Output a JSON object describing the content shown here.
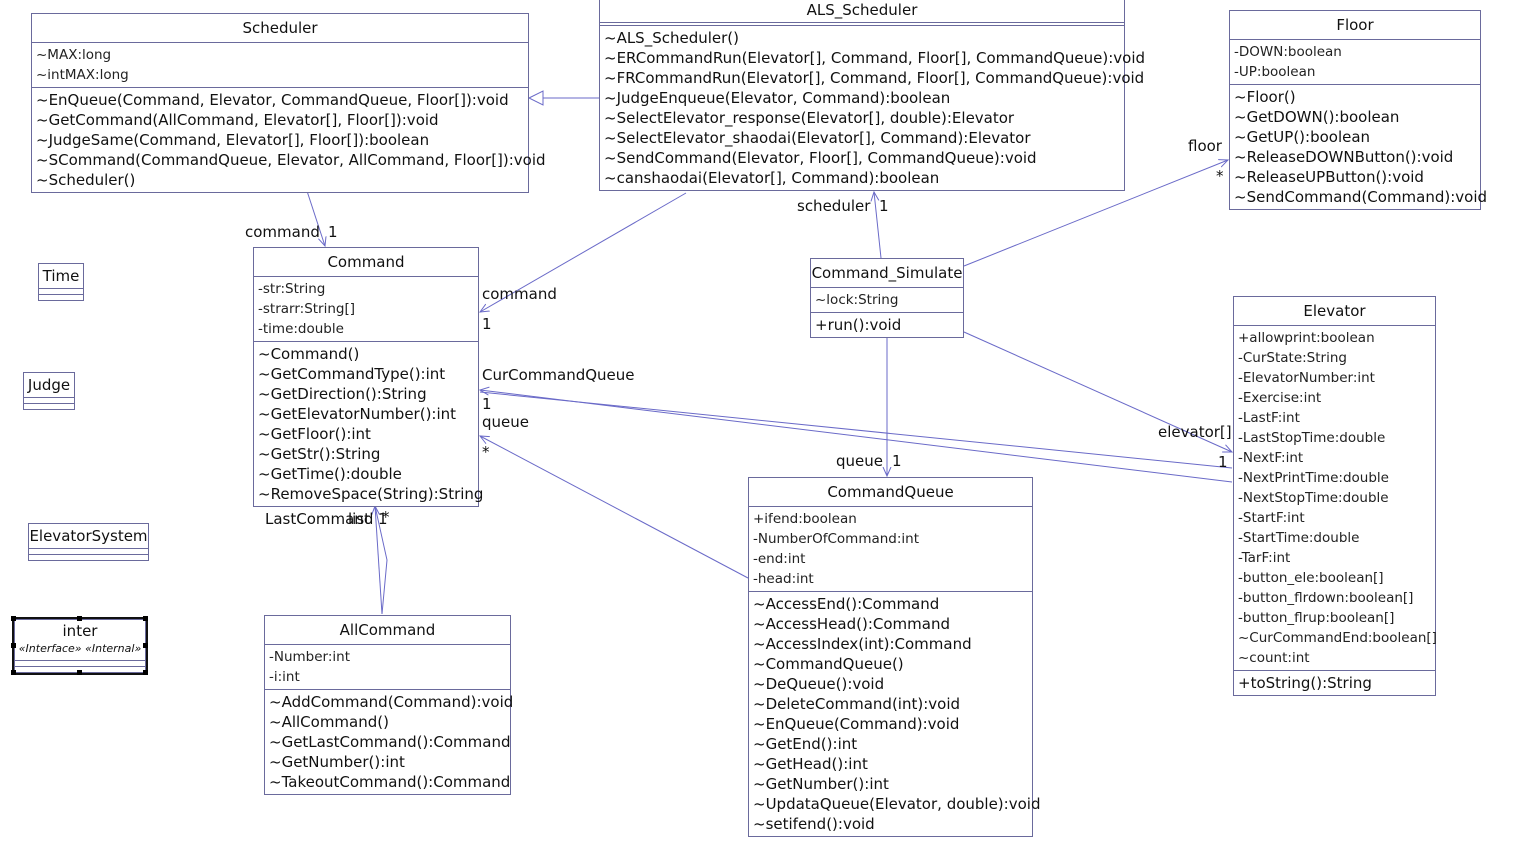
{
  "classes": [
    {
      "id": "scheduler",
      "name": "Scheduler",
      "attributes": [
        "~MAX:long",
        "~intMAX:long"
      ],
      "methods": [
        "~EnQueue(Command, Elevator, CommandQueue, Floor[]):void",
        "~GetCommand(AllCommand, Elevator[], Floor[]):void",
        "~JudgeSame(Command, Elevator[], Floor[]):boolean",
        "~SCommand(CommandQueue, Elevator, AllCommand, Floor[]):void",
        "~Scheduler()"
      ]
    },
    {
      "id": "als",
      "name": "ALS_Scheduler",
      "attributes": [],
      "methods": [
        "~ALS_Scheduler()",
        "~ERCommandRun(Elevator[], Command, Floor[], CommandQueue):void",
        "~FRCommandRun(Elevator[], Command, Floor[], CommandQueue):void",
        "~JudgeEnqueue(Elevator, Command):boolean",
        "~SelectElevator_response(Elevator[], double):Elevator",
        "~SelectElevator_shaodai(Elevator[], Command):Elevator",
        "~SendCommand(Elevator, Floor[], CommandQueue):void",
        "~canshaodai(Elevator[], Command):boolean"
      ]
    },
    {
      "id": "floor",
      "name": "Floor",
      "attributes": [
        "-DOWN:boolean",
        "-UP:boolean"
      ],
      "methods": [
        "~Floor()",
        "~GetDOWN():boolean",
        "~GetUP():boolean",
        "~ReleaseDOWNButton():void",
        "~ReleaseUPButton():void",
        "~SendCommand(Command):void"
      ]
    },
    {
      "id": "command",
      "name": "Command",
      "attributes": [
        "-str:String",
        "-strarr:String[]",
        "-time:double"
      ],
      "methods": [
        "~Command()",
        "~GetCommandType():int",
        "~GetDirection():String",
        "~GetElevatorNumber():int",
        "~GetFloor():int",
        "~GetStr():String",
        "~GetTime():double",
        "~RemoveSpace(String):String"
      ]
    },
    {
      "id": "sim",
      "name": "Command_Simulate",
      "attributes": [
        "~lock:String"
      ],
      "methods": [
        "+run():void"
      ]
    },
    {
      "id": "elevator",
      "name": "Elevator",
      "attributes": [
        "+allowprint:boolean",
        "-CurState:String",
        "-ElevatorNumber:int",
        "-Exercise:int",
        "-LastF:int",
        "-LastStopTime:double",
        "-NextF:int",
        "-NextPrintTime:double",
        "-NextStopTime:double",
        "-StartF:int",
        "-StartTime:double",
        "-TarF:int",
        "-button_ele:boolean[]",
        "-button_flrdown:boolean[]",
        "-button_flrup:boolean[]",
        "~CurCommandEnd:boolean[]",
        "~count:int"
      ],
      "methods": [
        "+toString():String"
      ]
    },
    {
      "id": "queue",
      "name": "CommandQueue",
      "attributes": [
        "+ifend:boolean",
        "-NumberOfCommand:int",
        "-end:int",
        "-head:int"
      ],
      "methods": [
        "~AccessEnd():Command",
        "~AccessHead():Command",
        "~AccessIndex(int):Command",
        "~CommandQueue()",
        "~DeQueue():void",
        "~DeleteCommand(int):void",
        "~EnQueue(Command):void",
        "~GetEnd():int",
        "~GetHead():int",
        "~GetNumber():int",
        "~UpdataQueue(Elevator, double):void",
        "~setifend():void"
      ]
    },
    {
      "id": "allcommand",
      "name": "AllCommand",
      "attributes": [
        "-Number:int",
        "-i:int"
      ],
      "methods": [
        "~AddCommand(Command):void",
        "~AllCommand()",
        "~GetLastCommand():Command",
        "~GetNumber():int",
        "~TakeoutCommand():Command"
      ]
    },
    {
      "id": "time",
      "name": "Time",
      "attributes": [],
      "methods": []
    },
    {
      "id": "judge",
      "name": "Judge",
      "attributes": [],
      "methods": []
    },
    {
      "id": "elevatorsystem",
      "name": "ElevatorSystem",
      "attributes": [],
      "methods": []
    },
    {
      "id": "inter",
      "name": "inter",
      "stereotype": "«Interface» «Internal»",
      "attributes": [],
      "methods": []
    }
  ],
  "edge_labels": {
    "sched_command_role": "command",
    "sched_command_mult": "1",
    "als_command_role": "command",
    "als_command_mult": "1",
    "sim_als_role": "scheduler",
    "sim_als_mult": "1",
    "sim_floor_role": "floor",
    "sim_floor_mult": "*",
    "sim_queue_role": "queue",
    "sim_queue_mult": "1",
    "sim_elev_role": "elevator[]",
    "sim_elev_mult": "1",
    "elev_cmd_role": "CurCommandQueue",
    "elev_cmd_mult": "1",
    "queue_cmd_role": "queue",
    "queue_cmd_mult": "*",
    "all_cmd_role1": "LastCommand",
    "all_cmd_role2": "list",
    "all_cmd_mult1": "1",
    "all_cmd_mult2": "*"
  },
  "colors": {
    "line": "#6a6ac8",
    "border": "#6a6a9c"
  }
}
